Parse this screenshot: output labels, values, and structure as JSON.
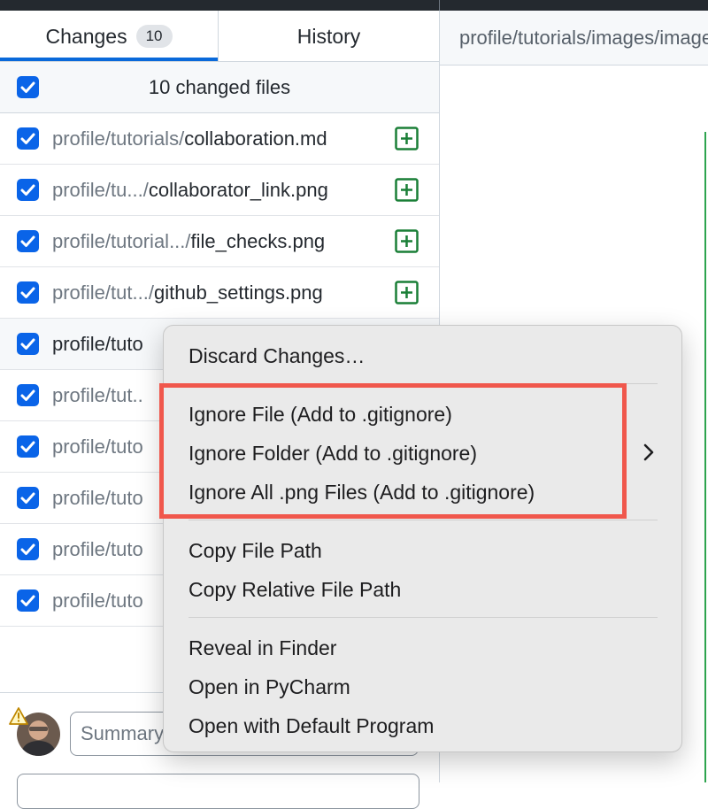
{
  "tabs": {
    "changes_label": "Changes",
    "changes_count": "10",
    "history_label": "History"
  },
  "changes_header": {
    "text": "10 changed files"
  },
  "files": [
    {
      "dir": "profile/tutorials/",
      "name": "collaboration.md",
      "status_icon": "plus-square-icon"
    },
    {
      "dir": "profile/tu.../",
      "name": "collaborator_link.png",
      "status_icon": "plus-square-icon"
    },
    {
      "dir": "profile/tutorial.../",
      "name": "file_checks.png",
      "status_icon": "plus-square-icon"
    },
    {
      "dir": "profile/tut.../",
      "name": "github_settings.png",
      "status_icon": "plus-square-icon"
    },
    {
      "dir": "profile/tuto",
      "name": ""
    },
    {
      "dir": "profile/tut..",
      "name": ""
    },
    {
      "dir": "profile/tuto",
      "name": ""
    },
    {
      "dir": "profile/tuto",
      "name": ""
    },
    {
      "dir": "profile/tuto",
      "name": ""
    },
    {
      "dir": "profile/tuto",
      "name": ""
    }
  ],
  "commit": {
    "summary_placeholder": "Summary (required)"
  },
  "diff_view": {
    "path": "profile/tutorials/images/image.png"
  },
  "context_menu": {
    "discard": "Discard Changes…",
    "ignore_file": "Ignore File (Add to .gitignore)",
    "ignore_folder": "Ignore Folder (Add to .gitignore)",
    "ignore_all": "Ignore All .png Files (Add to .gitignore)",
    "copy_path": "Copy File Path",
    "copy_relative": "Copy Relative File Path",
    "reveal": "Reveal in Finder",
    "open_in": "Open in PyCharm",
    "open_default": "Open with Default Program"
  },
  "colors": {
    "accent": "#0969da",
    "checkbox": "#0a64e8",
    "added": "#1a7f37",
    "highlight": "#f0574c"
  }
}
